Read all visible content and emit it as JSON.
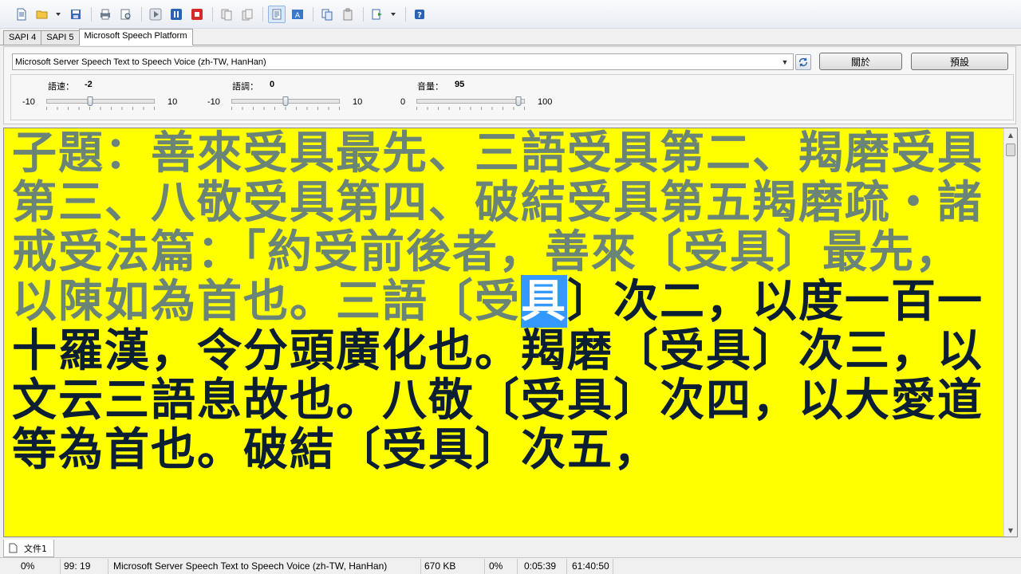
{
  "tabs": [
    {
      "label": "SAPI 4"
    },
    {
      "label": "SAPI 5"
    },
    {
      "label": "Microsoft Speech Platform"
    }
  ],
  "voice": {
    "selected": "Microsoft Server Speech Text to Speech Voice (zh-TW, HanHan)"
  },
  "buttons": {
    "about": "關於",
    "default": "預設"
  },
  "sliders": {
    "rate": {
      "label": "語速：",
      "value": "-2",
      "min": "-10",
      "max": "10"
    },
    "pitch": {
      "label": "語調：",
      "value": "0",
      "min": "-10",
      "max": "10"
    },
    "volume": {
      "label": "音量：",
      "value": "95",
      "min": "0",
      "max": "100"
    }
  },
  "text": {
    "read": "子題：善來受具最先、三語受具第二、羯磨受具第三、八敬受具第四、破結受具第五羯磨疏・諸戒受法篇：「約受前後者，善來〔受具〕最先，以陳如為首也。三語〔受",
    "highlight": "具",
    "unread": "〕次二，以度一百一十羅漢，令分頭廣化也。羯磨〔受具〕次三，以文云三語息故也。八敬〔受具〕次四，以大愛道等為首也。破結〔受具〕次五，"
  },
  "document": {
    "tab_label": "文件1"
  },
  "status": {
    "percent": "0%",
    "position": "99: 19",
    "voice": "Microsoft Server Speech Text to Speech Voice (zh-TW, HanHan)",
    "size": "670 KB",
    "progress": "0%",
    "elapsed": "0:05:39",
    "total": "61:40:50"
  },
  "colors": {
    "text_background": "#ffff00",
    "read_text": "#6b8478",
    "unread_text": "#0b1e33",
    "highlight": "#3399ff"
  }
}
